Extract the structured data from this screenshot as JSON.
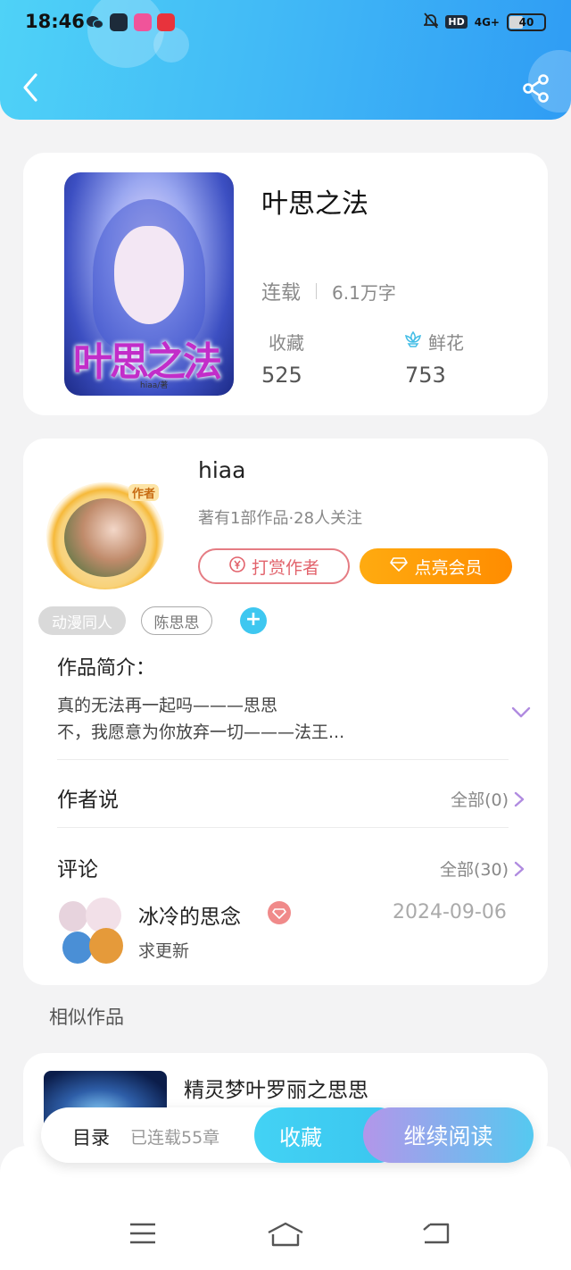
{
  "status_bar": {
    "time": "18:46",
    "network": "4G+",
    "hd": "HD",
    "battery": "40"
  },
  "book": {
    "cover_title": "叶思之法",
    "cover_byline": "hiaa/著",
    "title": "叶思之法",
    "status": "连载",
    "word_count": "6.1万字",
    "favorites_label": "收藏",
    "favorites_value": "525",
    "flowers_label": "鲜花",
    "flowers_value": "753"
  },
  "author": {
    "avatar_tag": "作者",
    "name": "hiaa",
    "meta": "著有1部作品·28人关注",
    "tip_button": "打赏作者",
    "vip_button": "点亮会员",
    "tags": [
      "动漫同人",
      "陈思思"
    ],
    "add_tag": "+"
  },
  "intro": {
    "heading": "作品简介：",
    "line1": "真的无法再一起吗———思思",
    "line2": "不，我愿意为你放弃一切———法王..."
  },
  "author_says": {
    "heading": "作者说",
    "link": "全部(0)"
  },
  "comments": {
    "heading": "评论",
    "link": "全部(30)",
    "items": [
      {
        "user": "冰冷的思念",
        "date": "2024-09-06",
        "text": "求更新"
      }
    ]
  },
  "similar": {
    "heading": "相似作品",
    "items": [
      {
        "title": "精灵梦叶罗丽之思思"
      }
    ]
  },
  "bottom_bar": {
    "toc": "目录",
    "chapters": "已连载55章",
    "favorite": "收藏",
    "continue": "继续阅读"
  },
  "colors": {
    "header": "#3fb5f6",
    "accent_orange": "#ff9a0a",
    "accent_cyan": "#3ec7f0",
    "tip_red": "#e2636c"
  }
}
